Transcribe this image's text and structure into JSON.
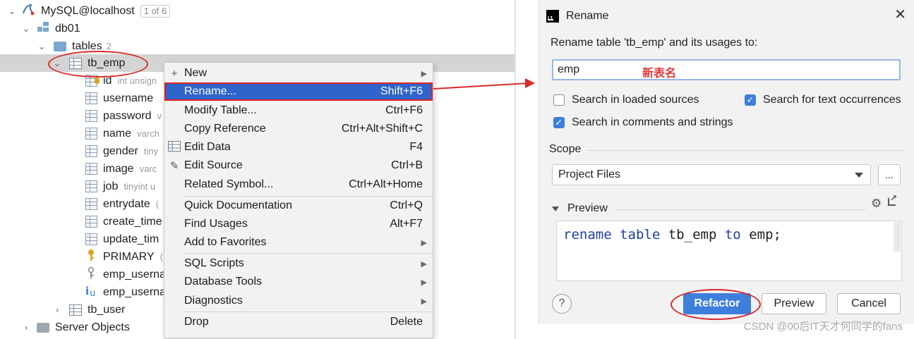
{
  "tree": {
    "connection": {
      "label": "MySQL@localhost",
      "badge": "1 of 6"
    },
    "database": {
      "label": "db01"
    },
    "tables_folder": {
      "label": "tables",
      "count": "2"
    },
    "selected_table": {
      "label": "tb_emp"
    },
    "columns": [
      {
        "name": "id",
        "hint": "int unsign",
        "icon": "column-key-icon"
      },
      {
        "name": "username",
        "hint": "",
        "icon": "column-icon"
      },
      {
        "name": "password",
        "hint": "v",
        "icon": "column-icon"
      },
      {
        "name": "name",
        "hint": "varch",
        "icon": "column-icon"
      },
      {
        "name": "gender",
        "hint": "tiny",
        "icon": "column-icon"
      },
      {
        "name": "image",
        "hint": "varc",
        "icon": "column-icon"
      },
      {
        "name": "job",
        "hint": "tinyint u",
        "icon": "column-icon"
      },
      {
        "name": "entrydate",
        "hint": "(",
        "icon": "column-icon"
      },
      {
        "name": "create_time",
        "hint": "",
        "icon": "column-icon"
      },
      {
        "name": "update_tim",
        "hint": "",
        "icon": "column-icon"
      }
    ],
    "keys": [
      {
        "name": "PRIMARY",
        "hint": "(",
        "icon": "primary-key-icon"
      },
      {
        "name": "emp_userna",
        "hint": "",
        "icon": "index-key-icon"
      },
      {
        "name": "emp_userna",
        "hint": "",
        "icon": "unique-index-icon"
      }
    ],
    "other_table": {
      "label": "tb_user"
    },
    "server_objects": {
      "label": "Server Objects"
    }
  },
  "menu": {
    "items": [
      {
        "label": "New",
        "shortcut": "",
        "submenu": true,
        "icon": "plus-icon"
      },
      {
        "label": "Rename...",
        "shortcut": "Shift+F6",
        "submenu": false,
        "icon": "",
        "active": true
      },
      {
        "label": "Modify Table...",
        "shortcut": "Ctrl+F6",
        "submenu": false,
        "icon": ""
      },
      {
        "label": "Copy Reference",
        "shortcut": "Ctrl+Alt+Shift+C",
        "submenu": false,
        "icon": ""
      },
      {
        "label": "Edit Data",
        "shortcut": "F4",
        "submenu": false,
        "icon": "table-grid-icon"
      },
      {
        "label": "Edit Source",
        "shortcut": "Ctrl+B",
        "submenu": false,
        "icon": "pencil-icon"
      },
      {
        "label": "Related Symbol...",
        "shortcut": "Ctrl+Alt+Home",
        "submenu": false,
        "icon": ""
      },
      {
        "label": "Quick Documentation",
        "shortcut": "Ctrl+Q",
        "submenu": false,
        "icon": ""
      },
      {
        "label": "Find Usages",
        "shortcut": "Alt+F7",
        "submenu": false,
        "icon": ""
      },
      {
        "label": "Add to Favorites",
        "shortcut": "",
        "submenu": true,
        "icon": ""
      },
      {
        "label": "SQL Scripts",
        "shortcut": "",
        "submenu": true,
        "icon": ""
      },
      {
        "label": "Database Tools",
        "shortcut": "",
        "submenu": true,
        "icon": ""
      },
      {
        "label": "Diagnostics",
        "shortcut": "",
        "submenu": true,
        "icon": ""
      },
      {
        "label": "Drop",
        "shortcut": "Delete",
        "submenu": false,
        "icon": ""
      }
    ]
  },
  "dialog": {
    "title": "Rename",
    "prompt": "Rename table 'tb_emp' and its usages to:",
    "new_name": "emp",
    "annotation": "新表名",
    "options": {
      "search_loaded_sources": {
        "label": "Search in loaded sources",
        "checked": false
      },
      "search_text_occurrences": {
        "label": "Search for text occurrences",
        "checked": true
      },
      "search_comments": {
        "label": "Search in comments and strings",
        "checked": true
      }
    },
    "scope_label": "Scope",
    "scope_value": "Project Files",
    "dots_label": "...",
    "preview_label": "Preview",
    "code": {
      "kw1": "rename",
      "kw2": "table",
      "old": "tb_emp",
      "kw3": "to",
      "new": "emp;"
    },
    "help_label": "?",
    "refactor_label": "Refactor",
    "preview_button_label": "Preview",
    "cancel_label": "Cancel"
  },
  "watermark": "CSDN @00后IT天才何同学的fans",
  "colors": {
    "accent": "#3d7fdb",
    "menu_highlight": "#2f65ca",
    "annotation": "#d92a2a"
  }
}
